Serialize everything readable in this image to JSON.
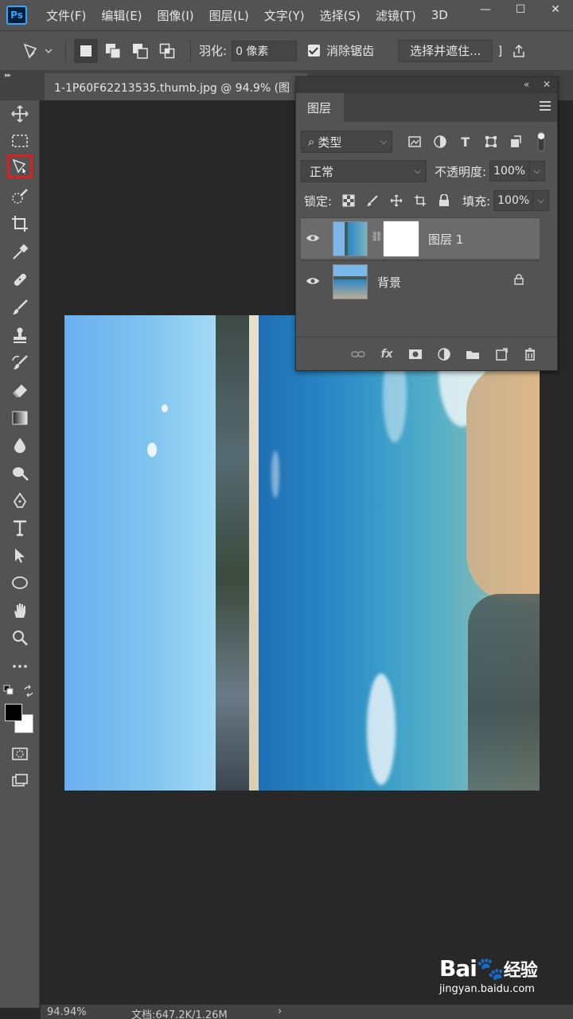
{
  "app": {
    "logo": "Ps",
    "menu": [
      "文件(F)",
      "编辑(E)",
      "图像(I)",
      "图层(L)",
      "文字(Y)",
      "选择(S)",
      "滤镜(T)",
      "3D"
    ],
    "window_controls": [
      "—",
      "☐",
      "✕"
    ]
  },
  "options_bar": {
    "feather_label": "羽化:",
    "feather_value": "0 像素",
    "antialias_label": "消除锯齿",
    "select_mask_label": "选择并遮住...",
    "bracket": "]"
  },
  "document": {
    "tab_title": "1-1P60F62213535.thumb.jpg @ 94.9% (图",
    "collapse_glyph": "▸▸"
  },
  "toolbar": {
    "active_tool": "magnetic-lasso-tool"
  },
  "layers_panel": {
    "tab_label": "图层",
    "filter_label": "类型",
    "blend_mode": "正常",
    "opacity_label": "不透明度:",
    "opacity_value": "100%",
    "lock_label": "锁定:",
    "fill_label": "填充:",
    "fill_value": "100%",
    "layers": [
      {
        "name": "图层 1",
        "visible": true,
        "selected": true,
        "has_mask": true
      },
      {
        "name": "背景",
        "visible": true,
        "selected": false,
        "locked": true
      }
    ]
  },
  "status_bar": {
    "zoom": "94.94%",
    "doc_info": "文档:647.2K/1.26M",
    "arrow": "›"
  },
  "watermark": {
    "logo_text": "Bai",
    "logo_text2": "经验",
    "url": "jingyan.baidu.com"
  },
  "colors": {
    "ui_bg": "#535353",
    "canvas_bg": "#282828",
    "highlight": "#e21d1d",
    "ps_blue": "#31a8ff"
  }
}
